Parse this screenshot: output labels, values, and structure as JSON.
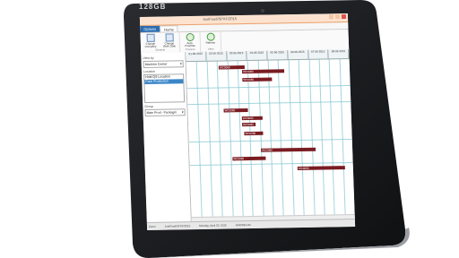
{
  "device": {
    "brand_text": "128GB",
    "colors": {
      "bezel": "#1b1d20",
      "accent": "#2b6cb0",
      "bar": "#7a1c22",
      "grid": "#7ec3cf",
      "titlebar": "#fde3cf"
    }
  },
  "window": {
    "title": "JustFood/SPXF/2015",
    "ribbon_tabs": [
      {
        "label": "Options"
      },
      {
        "label": "Home"
      }
    ],
    "ribbon_groups": [
      {
        "name": "General",
        "buttons": [
          {
            "label": "Change Company",
            "icon": "company-icon"
          },
          {
            "label": "Change Work Date",
            "icon": "calendar-icon"
          }
        ]
      },
      {
        "name": "Process",
        "buttons": [
          {
            "label": "Auto-Prioritize",
            "icon": "refresh-icon"
          }
        ]
      },
      {
        "name": "View",
        "buttons": [
          {
            "label": "Refresh",
            "icon": "refresh-icon"
          }
        ]
      }
    ]
  },
  "sidebar": {
    "view_by_label": "View by",
    "view_by_value": "Machine Center",
    "location_label": "Location",
    "location_items": [
      "Hold QS Location",
      "Pack Production"
    ],
    "location_selected": 1,
    "group_label": "Group",
    "group_value": "Main Prod - Packagin"
  },
  "gantt": {
    "dates": [
      "01-06-2015",
      "02-06-2015",
      "03-06-2015",
      "04-06-2015",
      "05-06-2015",
      "06-06-2015",
      "07-06-2015",
      "08-06-2015"
    ],
    "bars": [
      {
        "label": "WC0080"
      },
      {
        "label": "WC0080"
      },
      {
        "label": "WC0080"
      },
      {
        "label": "WC0080"
      },
      {
        "label": "WC0080"
      },
      {
        "label": "WC0080"
      },
      {
        "label": "WC0080"
      },
      {
        "label": "WC0080"
      },
      {
        "label": "WC0080"
      },
      {
        "label": "WC0080"
      }
    ]
  },
  "statusbar": {
    "items": [
      "Zoom",
      "JustFood/SPXF/2015",
      "Monday, April 20, 2015",
      "AAR/Director"
    ]
  }
}
